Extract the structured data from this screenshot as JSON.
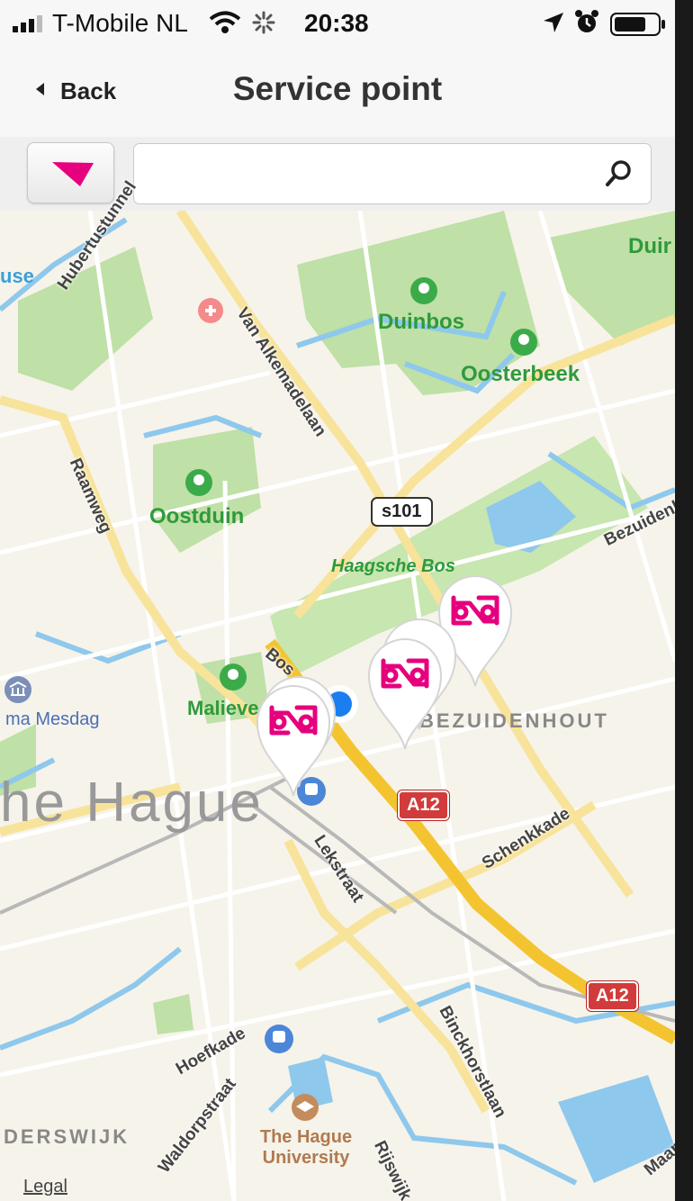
{
  "status_bar": {
    "carrier": "T-Mobile NL",
    "time": "20:38"
  },
  "nav": {
    "back_label": "Back",
    "title": "Service point"
  },
  "search": {
    "value": "",
    "placeholder": ""
  },
  "map": {
    "parks": {
      "duinbos": "Duinbos",
      "oosterbeek": "Oosterbeek",
      "oostduin": "Oostduin",
      "haagsche_bos": "Haagsche Bos",
      "malieveld": "Malieve",
      "duin_top_right": "Duir"
    },
    "streets": {
      "hubertustunnel": "Hubertustunnel",
      "van_alkemadelaan": "Van Alkemadelaan",
      "raamweg": "Raamweg",
      "bezuidenhout_road": "Bezuidenh",
      "bos": "Bos",
      "lekstraat": "Lekstraat",
      "schenkkade": "Schenkkade",
      "binckhorstlaan": "Binckhorstlaan",
      "hoefkade": "Hoefkade",
      "waldorpstraat": "Waldorpstraat",
      "rijswijk": "Rijswijk",
      "maan": "Maan"
    },
    "districts": {
      "bezuidenhout": "BEZUIDENHOUT",
      "laakkwartier": "DERSWIJK",
      "left_edge": "use"
    },
    "city": "he Hague",
    "pois": {
      "mesdag": "ma Mesdag",
      "university": "The Hague University"
    },
    "road_shields": {
      "s101": "s101",
      "a12_top": "A12",
      "a12_bottom": "A12"
    },
    "legal": "Legal"
  },
  "colors": {
    "accent": "#e6007e",
    "user_location": "#1a7ef0"
  }
}
